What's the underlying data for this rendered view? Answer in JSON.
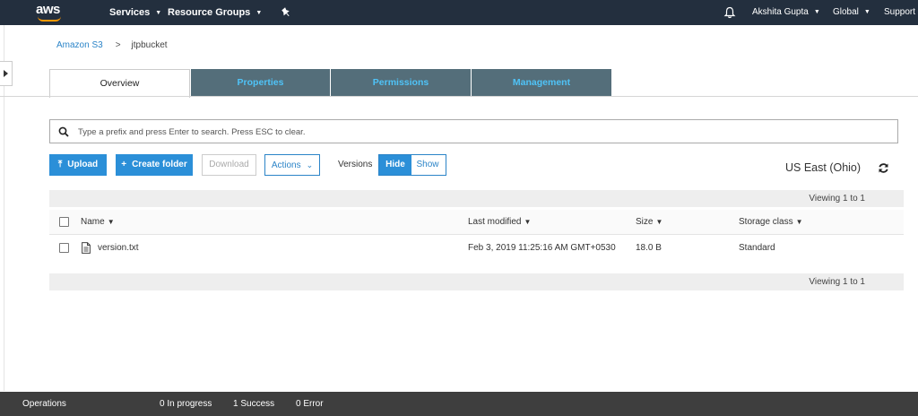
{
  "topnav": {
    "logo": "aws",
    "services": "Services",
    "resource_groups": "Resource Groups",
    "user": "Akshita Gupta",
    "region_menu": "Global",
    "support": "Support",
    "icons": {
      "pin": "pin-icon",
      "bell": "bell-icon"
    }
  },
  "breadcrumb": {
    "root": "Amazon S3",
    "separator": ">",
    "current": "jtpbucket"
  },
  "tabs": [
    {
      "label": "Overview",
      "active": true
    },
    {
      "label": "Properties",
      "active": false
    },
    {
      "label": "Permissions",
      "active": false
    },
    {
      "label": "Management",
      "active": false
    }
  ],
  "search": {
    "placeholder": "Type a prefix and press Enter to search. Press ESC to clear."
  },
  "toolbar": {
    "upload": "Upload",
    "create_folder": "Create folder",
    "download": "Download",
    "actions": "Actions",
    "versions_label": "Versions",
    "hide": "Hide",
    "show": "Show",
    "region": "US East (Ohio)"
  },
  "table": {
    "viewing_top": "Viewing 1 to 1",
    "viewing_bottom": "Viewing 1 to 1",
    "columns": {
      "name": "Name",
      "last_modified": "Last modified",
      "size": "Size",
      "storage_class": "Storage class"
    },
    "rows": [
      {
        "name": "version.txt",
        "last_modified": "Feb 3, 2019 11:25:16 AM GMT+0530",
        "size": "18.0 B",
        "storage_class": "Standard"
      }
    ]
  },
  "footer": {
    "operations": "Operations",
    "in_progress": "0 In progress",
    "success": "1 Success",
    "error": "0 Error"
  },
  "colors": {
    "nav_bg": "#232f3e",
    "accent": "#2b8fd8",
    "tab_bg": "#546e7a",
    "tab_text": "#4fc3f7",
    "footer_bg": "#3e3e3e",
    "logo_smile": "#ff9900"
  }
}
